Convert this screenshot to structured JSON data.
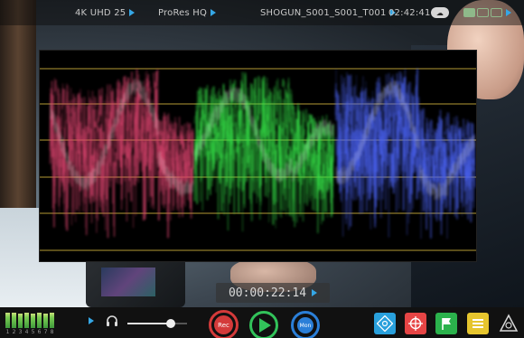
{
  "topbar": {
    "input": "4K UHD 25",
    "codec": "ProRes HQ",
    "clip_name": "SHOGUN_S001_S001_T001",
    "time": "02:42:41",
    "cloud": "on"
  },
  "timecode": "00:00:22:14",
  "audio": {
    "channel_labels": [
      "1",
      "2",
      "3",
      "4",
      "5",
      "6",
      "7",
      "8"
    ],
    "levels": [
      0.88,
      0.92,
      0.84,
      0.9,
      0.86,
      0.91,
      0.82,
      0.87
    ],
    "volume": 0.72
  },
  "transport": {
    "rec_label": "Rec",
    "mon_label": "Mon"
  },
  "tools": [
    "focus-peaking",
    "crosshair",
    "flag",
    "menu",
    "warning"
  ],
  "colors": {
    "accent": "#35a7e6",
    "rec": "#d43a3a",
    "play": "#32c25a",
    "mon": "#2b7fd8",
    "tool_blue": "#29a0dc",
    "tool_red": "#e64545",
    "tool_green": "#2bb24c",
    "tool_yellow": "#e6c52e",
    "waveform_red": "#d9436d",
    "waveform_green": "#35e047",
    "waveform_blue": "#4a62f2",
    "gridline": "#d4b63e"
  }
}
